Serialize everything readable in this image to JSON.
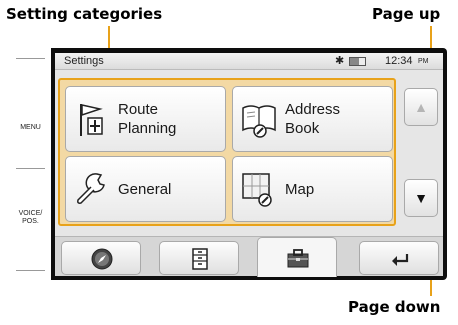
{
  "annotations": {
    "setting_categories": "Setting categories",
    "page_up": "Page up",
    "page_down": "Page down"
  },
  "side_panel": {
    "menu_label": "MENU",
    "voice_label_line1": "VOICE/",
    "voice_label_line2": "POS."
  },
  "status_bar": {
    "title": "Settings",
    "bluetooth_icon": "bluetooth-icon",
    "battery_icon": "battery-icon",
    "time": "12:34",
    "ampm": "PM"
  },
  "categories": [
    {
      "line1": "Route",
      "line2": "Planning",
      "icon": "route-flag-icon"
    },
    {
      "line1": "Address",
      "line2": "Book",
      "icon": "address-book-icon"
    },
    {
      "line1": "General",
      "line2": "",
      "icon": "wrench-icon"
    },
    {
      "line1": "Map",
      "line2": "",
      "icon": "map-icon"
    }
  ],
  "scroll": {
    "up_glyph": "▲",
    "down_glyph": "▼"
  },
  "bottom_bar": [
    {
      "icon": "compass-icon"
    },
    {
      "icon": "cabinet-icon"
    },
    {
      "icon": "toolbox-icon",
      "selected": true
    },
    {
      "icon": "back-arrow-icon"
    }
  ],
  "colors": {
    "accent": "#e8a21a",
    "highlight_bg": "#f3d9a4",
    "device_frame": "#0e0e0e"
  }
}
